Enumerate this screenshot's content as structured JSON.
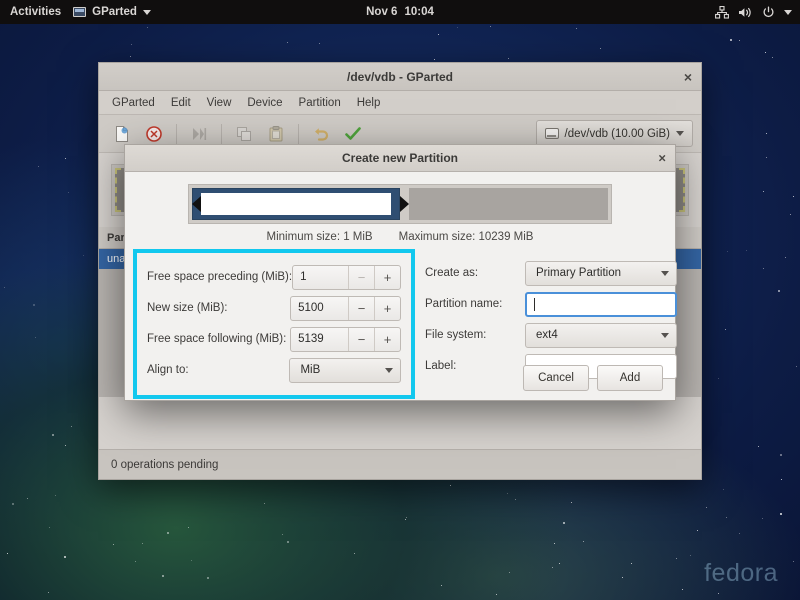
{
  "topbar": {
    "activities": "Activities",
    "app_name": "GParted",
    "app_icon": "window-icon",
    "date": "Nov 6",
    "time": "10:04",
    "tray_icons": [
      "network-icon",
      "volume-icon",
      "power-icon",
      "chevron-down-icon"
    ]
  },
  "desktop": {
    "watermark": "fedora"
  },
  "gparted": {
    "title": "/dev/vdb - GParted",
    "close_label": "×",
    "menus": [
      "GParted",
      "Edit",
      "View",
      "Device",
      "Partition",
      "Help"
    ],
    "toolbar_icons": [
      "new-partition-icon",
      "delete-partition-icon",
      "resize-move-icon",
      "copy-icon",
      "paste-icon",
      "undo-icon",
      "apply-icon"
    ],
    "device_selector": {
      "icon": "disk-icon",
      "label": "/dev/vdb (10.00 GiB)",
      "caret": "chevron-down-icon"
    },
    "table": {
      "headers": [
        "Partition"
      ],
      "selected_row": "unallocated"
    },
    "status": "0 operations pending"
  },
  "dialog": {
    "title": "Create new Partition",
    "close_label": "×",
    "preview": {
      "min_size": "Minimum size: 1 MiB",
      "max_size": "Maximum size: 10239 MiB",
      "used_percent": 50
    },
    "left_fields": [
      {
        "label": "Free space preceding (MiB):",
        "value": "1",
        "type": "spinbutton",
        "minus": "−",
        "plus": "+",
        "minus_disabled": true
      },
      {
        "label": "New size (MiB):",
        "value": "5100",
        "type": "spinbutton",
        "minus": "−",
        "plus": "+",
        "minus_disabled": false
      },
      {
        "label": "Free space following (MiB):",
        "value": "5139",
        "type": "spinbutton",
        "minus": "−",
        "plus": "+",
        "minus_disabled": false
      },
      {
        "label": "Align to:",
        "value": "MiB",
        "type": "combobox"
      }
    ],
    "right_fields": [
      {
        "label": "Create as:",
        "value": "Primary Partition",
        "type": "combobox"
      },
      {
        "label": "Partition name:",
        "value": "",
        "type": "textinput",
        "focused": true
      },
      {
        "label": "File system:",
        "value": "ext4",
        "type": "combobox"
      },
      {
        "label": "Label:",
        "value": "",
        "type": "textinput",
        "focused": false
      }
    ],
    "buttons": {
      "cancel": "Cancel",
      "add": "Add"
    },
    "highlight_color": "#12c8ee"
  }
}
